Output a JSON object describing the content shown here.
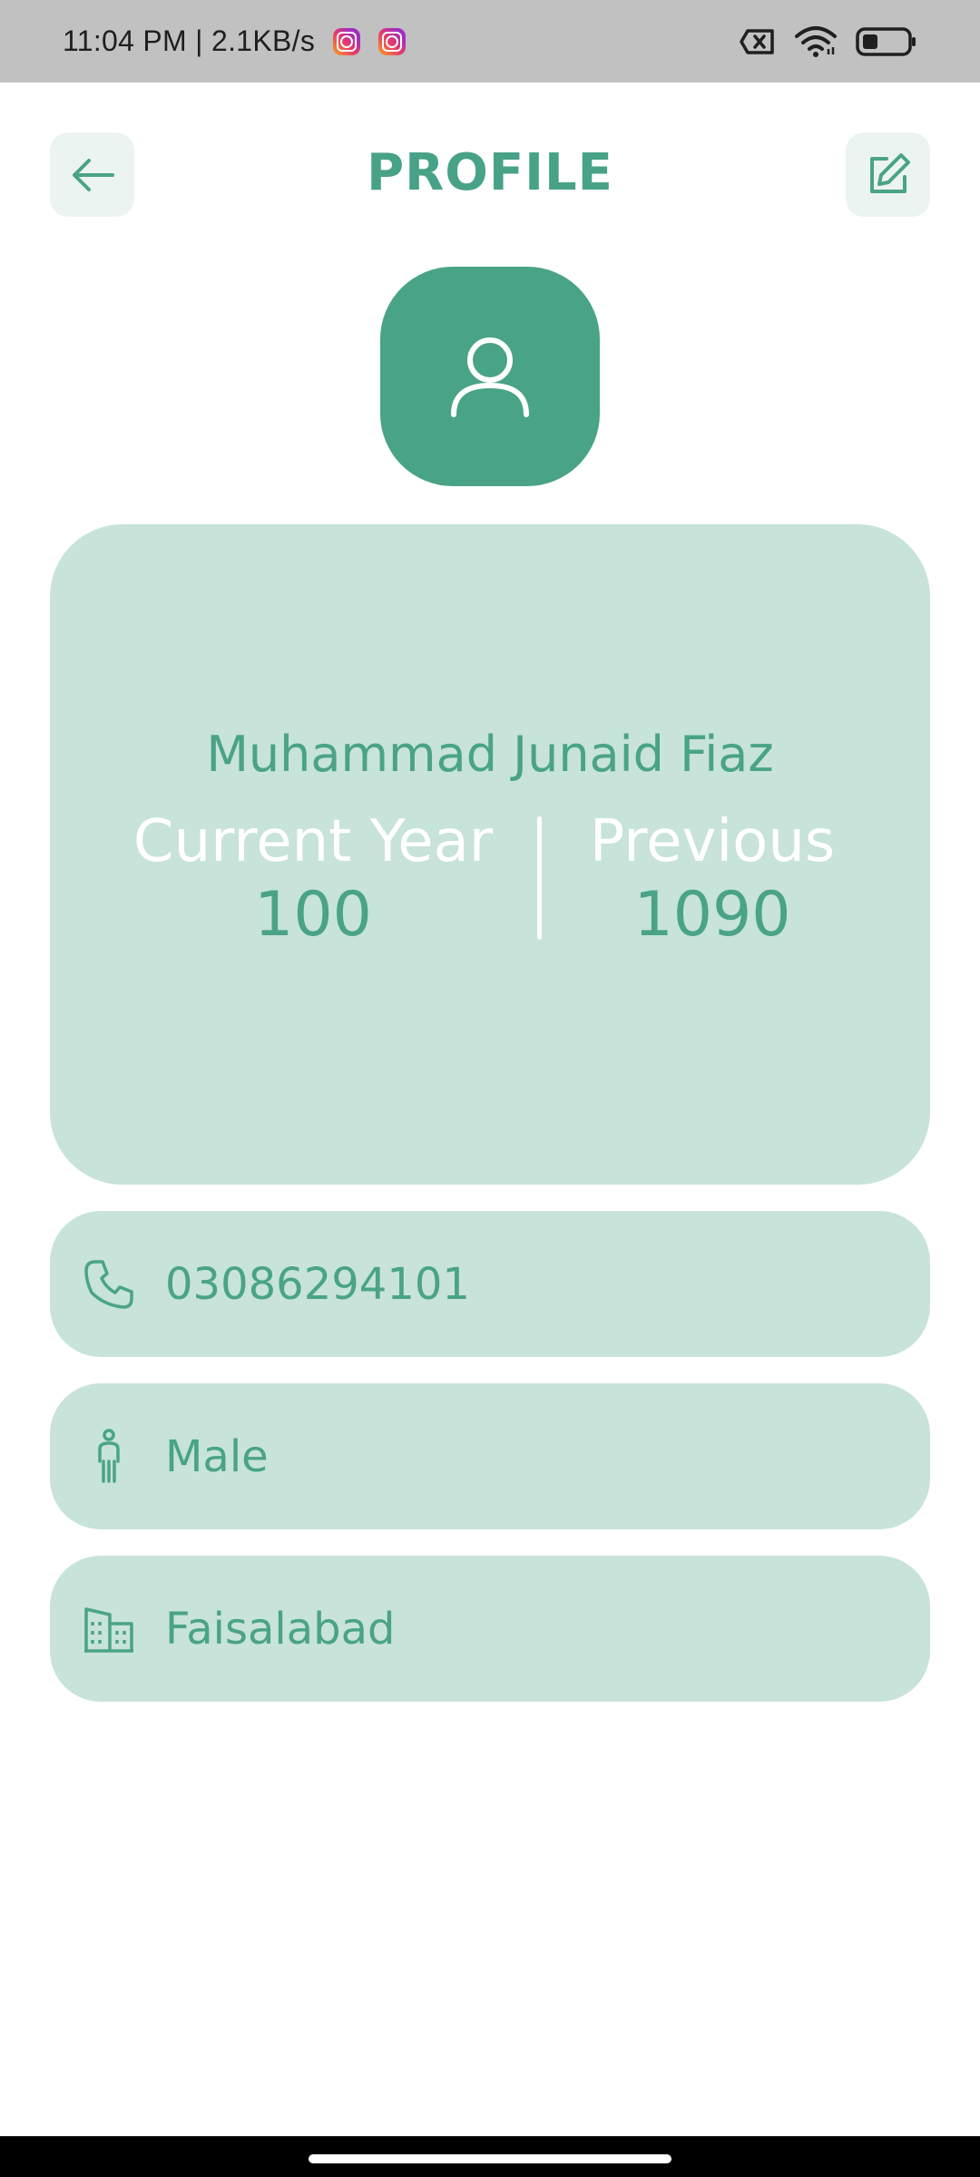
{
  "status_bar": {
    "time_speed": "11:04 PM | 2.1KB/s",
    "notification_icons": [
      "instagram-icon",
      "instagram-icon"
    ],
    "right_icons": [
      "sim-disabled-icon",
      "wifi-icon",
      "battery-icon"
    ]
  },
  "header": {
    "title": "PROFILE",
    "back_icon": "arrow-left-icon",
    "edit_icon": "edit-icon"
  },
  "profile": {
    "avatar_icon": "user-icon",
    "name": "Muhammad Junaid Fiaz",
    "current_label": "Current Year",
    "current_value": "100",
    "previous_label": "Previous",
    "previous_value": "1090"
  },
  "details": {
    "phone": "03086294101",
    "gender": "Male",
    "city": "Faisalabad"
  },
  "colors": {
    "accent": "#49a387",
    "card_bg": "#c7e3da",
    "button_bg": "#ecf4f2",
    "status_bar_bg": "#c1c1c1"
  }
}
